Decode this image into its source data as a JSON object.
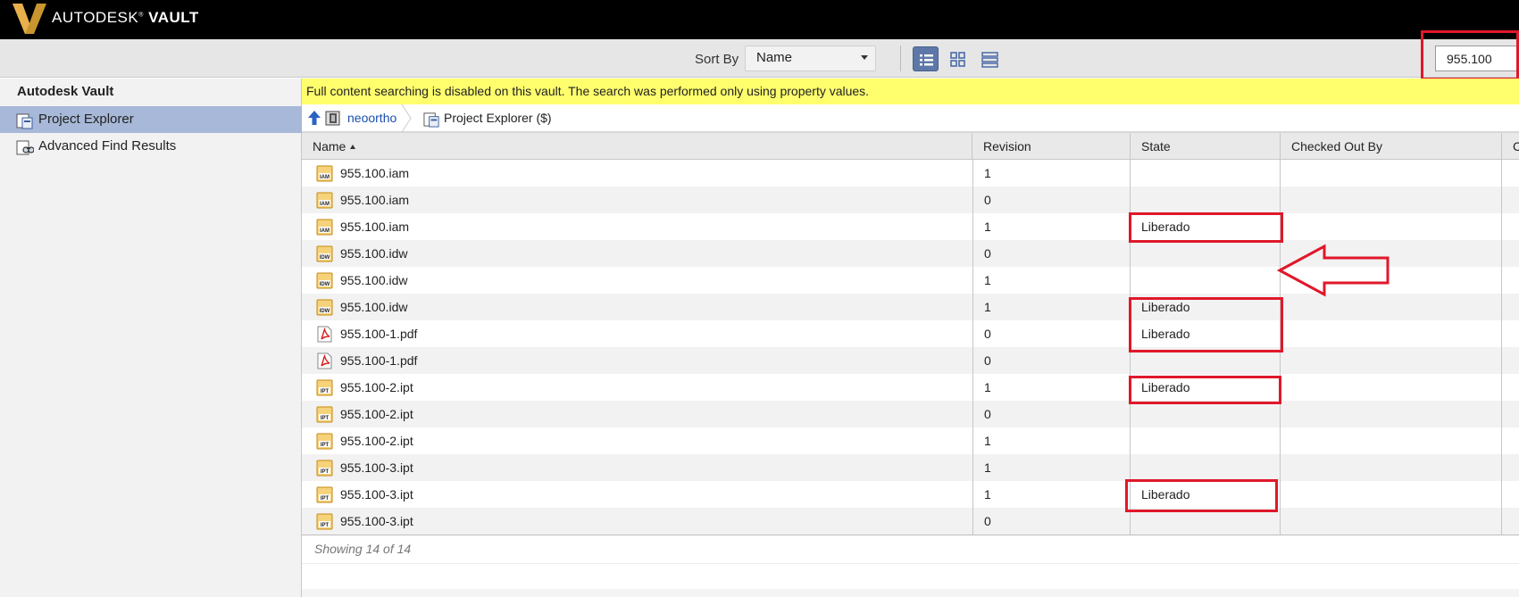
{
  "app": {
    "brand_prefix": "AUTODESK",
    "brand_product": "VAULT"
  },
  "toolbar": {
    "sort_by_label": "Sort By",
    "sort_value": "Name",
    "search_value": "955.100"
  },
  "nav": {
    "title": "Autodesk Vault",
    "items": [
      {
        "label": "Project Explorer",
        "selected": true
      },
      {
        "label": "Advanced Find Results",
        "selected": false
      }
    ]
  },
  "banner": {
    "text": "Full content searching is disabled on this vault. The search was performed only using property values."
  },
  "breadcrumb": {
    "vault": "neoortho",
    "folder": "Project Explorer ($)"
  },
  "table": {
    "columns": [
      "Name",
      "Revision",
      "State",
      "Checked Out By",
      "C"
    ],
    "rows": [
      {
        "name": "955.100.iam",
        "type": "iam",
        "revision": "1",
        "state": ""
      },
      {
        "name": "955.100.iam",
        "type": "iam",
        "revision": "0",
        "state": ""
      },
      {
        "name": "955.100.iam",
        "type": "iam",
        "revision": "1",
        "state": "Liberado"
      },
      {
        "name": "955.100.idw",
        "type": "idw",
        "revision": "0",
        "state": ""
      },
      {
        "name": "955.100.idw",
        "type": "idw",
        "revision": "1",
        "state": ""
      },
      {
        "name": "955.100.idw",
        "type": "idw",
        "revision": "1",
        "state": "Liberado"
      },
      {
        "name": "955.100-1.pdf",
        "type": "pdf",
        "revision": "0",
        "state": "Liberado"
      },
      {
        "name": "955.100-1.pdf",
        "type": "pdf",
        "revision": "0",
        "state": ""
      },
      {
        "name": "955.100-2.ipt",
        "type": "ipt",
        "revision": "1",
        "state": "Liberado"
      },
      {
        "name": "955.100-2.ipt",
        "type": "ipt",
        "revision": "0",
        "state": ""
      },
      {
        "name": "955.100-2.ipt",
        "type": "ipt",
        "revision": "1",
        "state": ""
      },
      {
        "name": "955.100-3.ipt",
        "type": "ipt",
        "revision": "1",
        "state": ""
      },
      {
        "name": "955.100-3.ipt",
        "type": "ipt",
        "revision": "1",
        "state": "Liberado"
      },
      {
        "name": "955.100-3.ipt",
        "type": "ipt",
        "revision": "0",
        "state": ""
      }
    ],
    "footer": "Showing 14 of 14"
  },
  "colors": {
    "annotation_red": "#e0182a",
    "banner_yellow": "#ffff6e",
    "selection_blue": "#a7b8d8",
    "active_view_blue": "#5d78a8"
  },
  "icons": {
    "file_icons": {
      "iam": "IAM",
      "idw": "IDW",
      "ipt": "IPT",
      "pdf": "pdf-icon"
    }
  }
}
